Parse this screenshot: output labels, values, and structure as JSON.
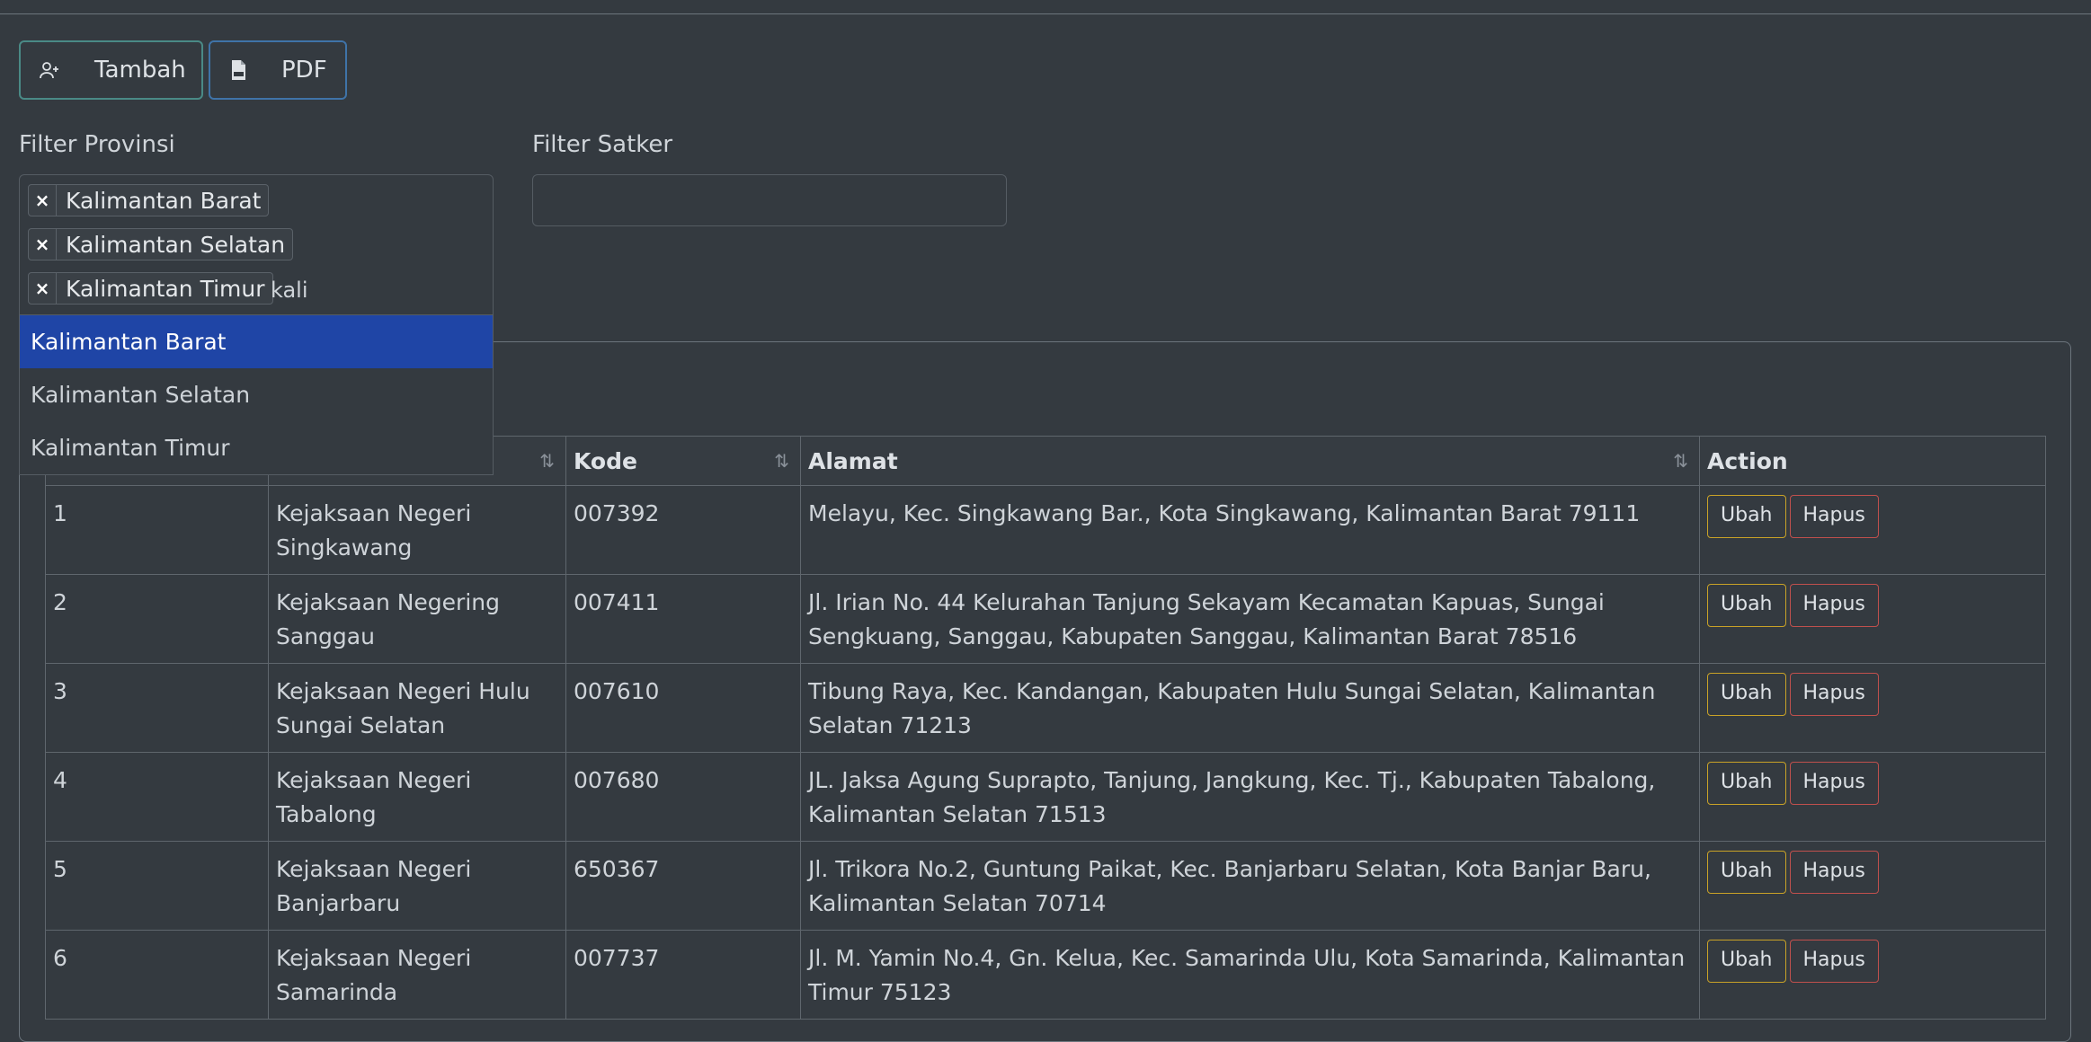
{
  "toolbar": {
    "add_label": "Tambah",
    "pdf_label": "PDF"
  },
  "filters": {
    "provinsi_label": "Filter Provinsi",
    "satker_label": "Filter Satker",
    "selected": [
      "Kalimantan Barat",
      "Kalimantan Selatan",
      "Kalimantan Timur"
    ],
    "search_text": "kali",
    "remove_glyph": "×",
    "options": [
      "Kalimantan Barat",
      "Kalimantan Selatan",
      "Kalimantan Timur"
    ],
    "highlighted_option": "Kalimantan Barat"
  },
  "table": {
    "headers": [
      "",
      "",
      "Kode",
      "Alamat",
      "Action"
    ],
    "sort_glyph": "⇅",
    "rows": [
      {
        "no": "1",
        "nama": "Kejaksaan Negeri Singkawang",
        "kode": "007392",
        "alamat": "Melayu, Kec. Singkawang Bar., Kota Singkawang, Kalimantan Barat 79111"
      },
      {
        "no": "2",
        "nama": "Kejaksaan Negering Sanggau",
        "kode": "007411",
        "alamat": "Jl. Irian No. 44 Kelurahan Tanjung Sekayam Kecamatan Kapuas, Sungai Sengkuang, Sanggau, Kabupaten Sanggau, Kalimantan Barat 78516"
      },
      {
        "no": "3",
        "nama": "Kejaksaan Negeri Hulu Sungai Selatan",
        "kode": "007610",
        "alamat": "Tibung Raya, Kec. Kandangan, Kabupaten Hulu Sungai Selatan, Kalimantan Selatan 71213"
      },
      {
        "no": "4",
        "nama": "Kejaksaan Negeri Tabalong",
        "kode": "007680",
        "alamat": "JL. Jaksa Agung Suprapto, Tanjung, Jangkung, Kec. Tj., Kabupaten Tabalong, Kalimantan Selatan 71513"
      },
      {
        "no": "5",
        "nama": "Kejaksaan Negeri Banjarbaru",
        "kode": "650367",
        "alamat": "Jl. Trikora No.2, Guntung Paikat, Kec. Banjarbaru Selatan, Kota Banjar Baru, Kalimantan Selatan 70714"
      },
      {
        "no": "6",
        "nama": "Kejaksaan Negeri Samarinda",
        "kode": "007737",
        "alamat": "Jl. M. Yamin No.4, Gn. Kelua, Kec. Samarinda Ulu, Kota Samarinda, Kalimantan Timur 75123"
      }
    ],
    "edit_label": "Ubah",
    "delete_label": "Hapus"
  },
  "icons": {
    "add": "user-plus-icon",
    "pdf": "pdf-file-icon"
  },
  "colors": {
    "background": "#343a40",
    "highlight": "#1f45a6",
    "edit_border": "#c9a227",
    "delete_border": "#c0504d"
  }
}
